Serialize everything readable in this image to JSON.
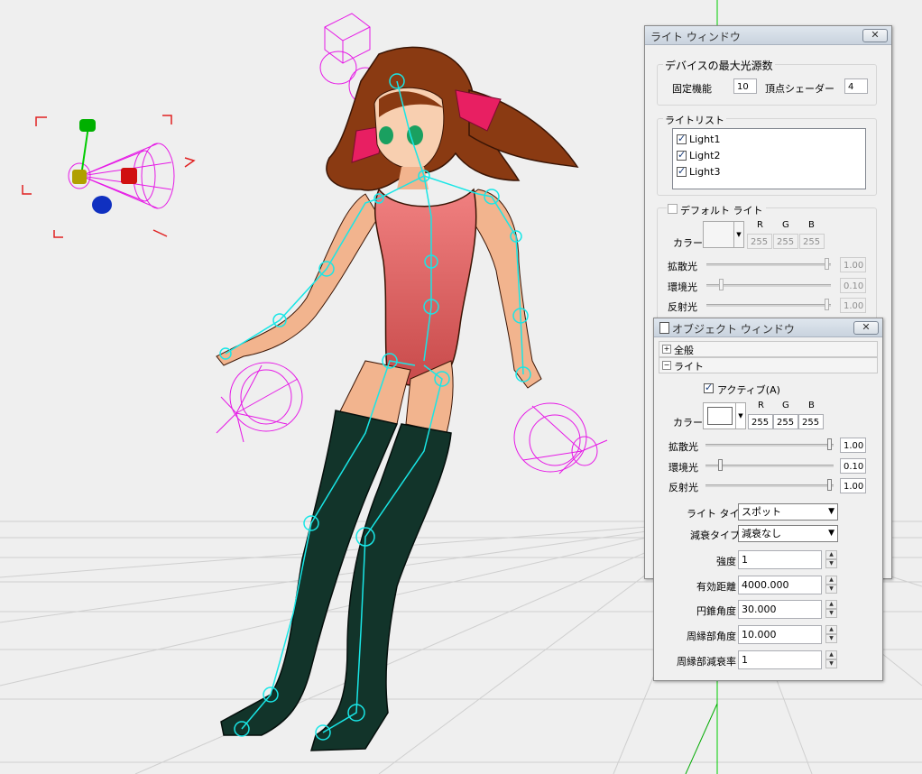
{
  "light_window": {
    "title": "ライト ウィンドウ",
    "close_label": "✕",
    "device_group": {
      "title": "デバイスの最大光源数",
      "fixed_label": "固定機能",
      "fixed_value": "10",
      "vertex_label": "頂点シェーダー",
      "vertex_value": "4"
    },
    "light_list": {
      "title": "ライトリスト",
      "items": [
        {
          "label": "Light1",
          "checked": true
        },
        {
          "label": "Light2",
          "checked": true
        },
        {
          "label": "Light3",
          "checked": true
        }
      ]
    },
    "default_light": {
      "label": "デフォルト ライト",
      "checked": false,
      "color_label": "カラー",
      "r_label": "R",
      "g_label": "G",
      "b_label": "B",
      "r": "255",
      "g": "255",
      "b": "255",
      "diffuse_label": "拡散光",
      "diffuse_value": "1.00",
      "diffuse_level": 1.0,
      "ambient_label": "環境光",
      "ambient_value": "0.10",
      "ambient_level": 0.1,
      "specular_label": "反射光",
      "specular_value": "1.00",
      "specular_level": 1.0
    }
  },
  "object_window": {
    "title": "オブジェクト ウィンドウ",
    "close_label": "✕",
    "general_label": "全般",
    "general_expander": "+",
    "light_label": "ライト",
    "light_expander": "−",
    "active_label": "アクティブ(A)",
    "active_checked": true,
    "color_label": "カラー",
    "r_label": "R",
    "g_label": "G",
    "b_label": "B",
    "r": "255",
    "g": "255",
    "b": "255",
    "diffuse_label": "拡散光",
    "diffuse_value": "1.00",
    "diffuse_level": 1.0,
    "ambient_label": "環境光",
    "ambient_value": "0.10",
    "ambient_level": 0.1,
    "specular_label": "反射光",
    "specular_value": "1.00",
    "specular_level": 1.0,
    "light_type_label": "ライト タイプ",
    "light_type_value": "スポット",
    "attenuation_type_label": "減衰タイプ",
    "attenuation_type_value": "減衰なし",
    "params": [
      {
        "label": "強度",
        "value": "1"
      },
      {
        "label": "有効距離",
        "value": "4000.000"
      },
      {
        "label": "円錐角度",
        "value": "30.000"
      },
      {
        "label": "周縁部角度",
        "value": "10.000"
      },
      {
        "label": "周縁部減衰率",
        "value": "1"
      }
    ]
  },
  "colors": {
    "bone": "#19e6e6",
    "light_gizmo": "#e619e6",
    "grid": "#c8c8c8",
    "axis_green": "#00cc00"
  }
}
